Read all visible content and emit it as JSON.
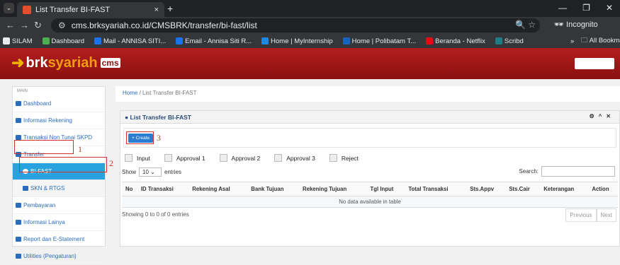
{
  "browser": {
    "tab_title": "List Transfer BI-FAST",
    "url": "cms.brksyariah.co.id/CMSBRK/transfer/bi-fast/list",
    "incognito": "Incognito",
    "new_tab": "+",
    "close_tab": "×"
  },
  "bookmarks": [
    {
      "label": "SILAM",
      "color": "#e8eaed"
    },
    {
      "label": "Dashboard",
      "color": "#4caf50"
    },
    {
      "label": "Mail - ANNISA SITI...",
      "color": "#1a73e8"
    },
    {
      "label": "Email - Annisa Siti R...",
      "color": "#1a73e8"
    },
    {
      "label": "Home | MyInternship",
      "color": "#1e88e5"
    },
    {
      "label": "Home | Polibatam T...",
      "color": "#1565c0"
    },
    {
      "label": "Beranda - Netflix",
      "color": "#e50914"
    },
    {
      "label": "Scribd",
      "color": "#1e7b85"
    }
  ],
  "bookmarks_more": "»",
  "all_bookmarks": "All Bookmarks",
  "app": {
    "logo_a": "brk",
    "logo_b": "syariah",
    "logo_c": "cms"
  },
  "sidebar": {
    "section": "MAIN",
    "items": [
      "Dashboard",
      "Informasi Rekening",
      "Transaksi Non Tunai SKPD",
      "Transfer",
      "BI-FAST",
      "SKN & RTGS",
      "Pembayaran",
      "Informasi Lainya",
      "Report dan E-Statement",
      "Utilities (Pengaturan)"
    ]
  },
  "annotations": [
    "1",
    "2",
    "3"
  ],
  "breadcrumb": {
    "home": "Home",
    "sep": "/",
    "current": "List Transfer BI-FAST"
  },
  "panel": {
    "title": "List Transfer BI-FAST",
    "create": "+ Create"
  },
  "filters": [
    "Input",
    "Approval 1",
    "Approval 2",
    "Approval 3",
    "Reject"
  ],
  "table": {
    "show": "Show",
    "entries_value": "10",
    "entries": "entries",
    "search": "Search:",
    "columns": [
      "No",
      "ID Transaksi",
      "Rekening Asal",
      "Bank Tujuan",
      "Rekening Tujuan",
      "Tgl Input",
      "Total Transaksi",
      "Sts.Appv",
      "Sts.Cair",
      "Keterangan",
      "Action"
    ],
    "empty": "No data available in table",
    "info": "Showing 0 to 0 of 0 entries",
    "prev": "Previous",
    "next": "Next"
  }
}
